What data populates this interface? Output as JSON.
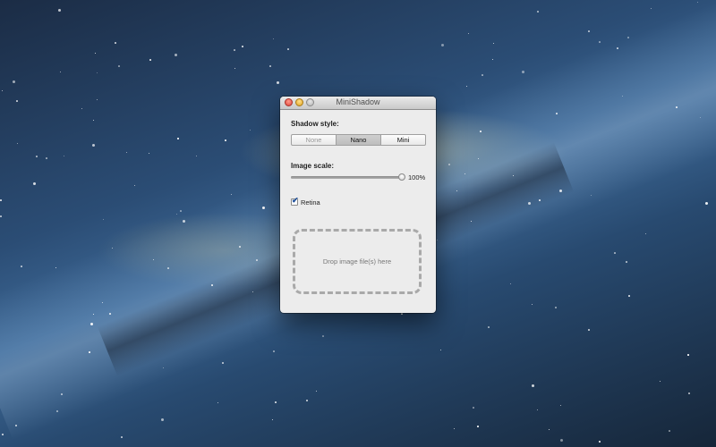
{
  "window": {
    "title": "MiniShadow"
  },
  "shadow_style": {
    "label": "Shadow style:",
    "options": [
      {
        "label": "None",
        "state": "disabled"
      },
      {
        "label": "Nano",
        "state": "selected"
      },
      {
        "label": "Mini",
        "state": "normal"
      }
    ]
  },
  "image_scale": {
    "label": "Image scale:",
    "value_percent": 100,
    "value_label": "100%"
  },
  "retina": {
    "label": "Retina",
    "checked": true
  },
  "dropzone": {
    "text": "Drop image file(s) here"
  },
  "colors": {
    "accent": "#1e4f9a",
    "window_bg": "#ececec"
  }
}
